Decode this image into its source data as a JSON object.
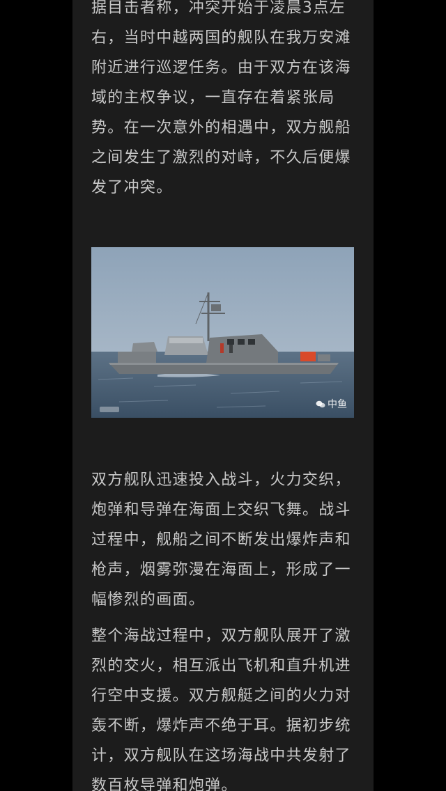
{
  "article": {
    "paragraphs": [
      {
        "lines": [
          "据目击者称，冲突开始于凌晨3点左",
          "右，当时中越两国的舰队在我万安滩",
          "附近进行巡逻任务。由于双方在该海",
          "域的主权争议，一直存在着紧张局",
          "势。在一次意外的相遇中，双方舰船",
          "之间发生了激烈的对峙，不久后便爆",
          "发了冲突。"
        ]
      },
      {
        "lines": [
          "双方舰队迅速投入战斗，火力交织，",
          "炮弹和导弹在海面上交织飞舞。战斗",
          "过程中，舰船之间不断发出爆炸声和",
          "枪声，烟雾弥漫在海面上，形成了一",
          "幅惨烈的画面。"
        ]
      },
      {
        "lines": [
          "整个海战过程中，双方舰队展开了激",
          "烈的交火，相互派出飞机和直升机进",
          "行空中支援。双方舰艇之间的火力对",
          "轰不断，爆炸声不绝于耳。据初步统",
          "计，双方舰队在这场海战中共发射了",
          "数百枚导弹和炮弹。"
        ]
      }
    ],
    "image": {
      "watermark_text": "中鱼"
    }
  },
  "colors": {
    "page_background": "#000000",
    "column_background": "#1c1c1c",
    "text": "#c8c8c8"
  }
}
